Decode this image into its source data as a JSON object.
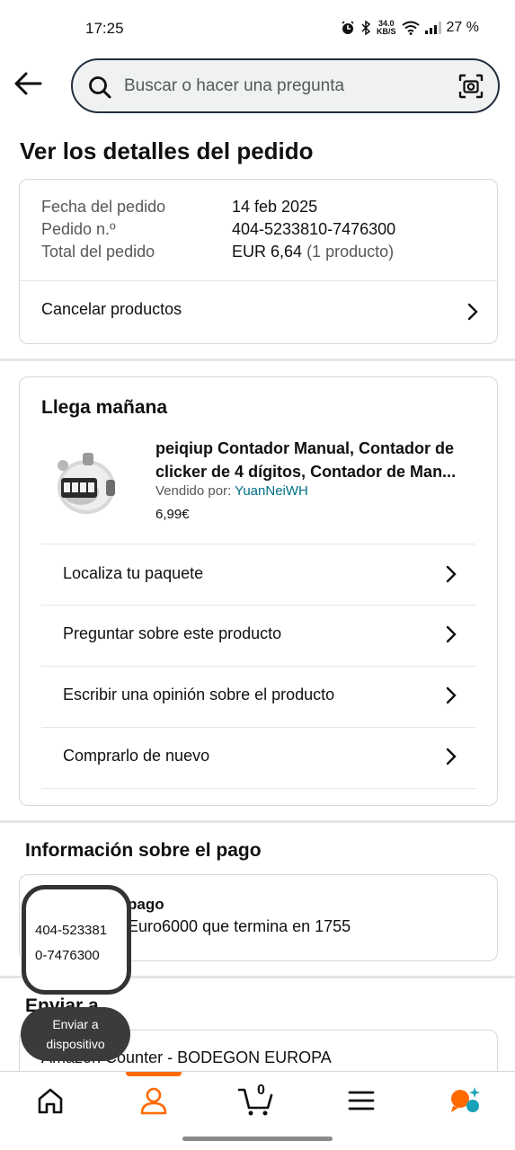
{
  "status_bar": {
    "time": "17:25",
    "speed_value": "34.0",
    "speed_unit": "KB/S",
    "battery": "27 %"
  },
  "search": {
    "placeholder": "Buscar o hacer una pregunta"
  },
  "page": {
    "title": "Ver los detalles del pedido"
  },
  "order_summary": {
    "date_label": "Fecha del pedido",
    "date_value": "14 feb 2025",
    "number_label": "Pedido n.º",
    "number_value": "404-5233810-7476300",
    "total_label": "Total del pedido",
    "total_value": "EUR 6,64",
    "total_count": "(1 producto)",
    "cancel_label": "Cancelar productos"
  },
  "shipment": {
    "title": "Llega mañana",
    "product_name": "peiqiup Contador Manual, Contador de clicker de 4 dígitos, Contador de Man...",
    "sold_by_label": "Vendido por:",
    "seller": "YuanNeiWH",
    "price": "6,99€",
    "actions": [
      {
        "label": "Localiza tu paquete"
      },
      {
        "label": "Preguntar sobre este producto"
      },
      {
        "label": "Escribir una opinión sobre el producto"
      },
      {
        "label": "Comprarlo de nuevo"
      }
    ]
  },
  "payment": {
    "section_title": "Información sobre el pago",
    "method_title": "pago",
    "method_value": "Euro6000  que termina en 1755"
  },
  "shipping": {
    "section_title": "Enviar a",
    "address": "Amazon Counter - BODEGON EUROPA"
  },
  "overlay": {
    "bubble_line1": "404-523381",
    "bubble_line2": "0-7476300",
    "send_line1": "Enviar a",
    "send_line2": "dispositivo"
  },
  "bottom_nav": {
    "cart_count": "0",
    "active_tab": "account",
    "accent_color": "#ff6a00"
  }
}
